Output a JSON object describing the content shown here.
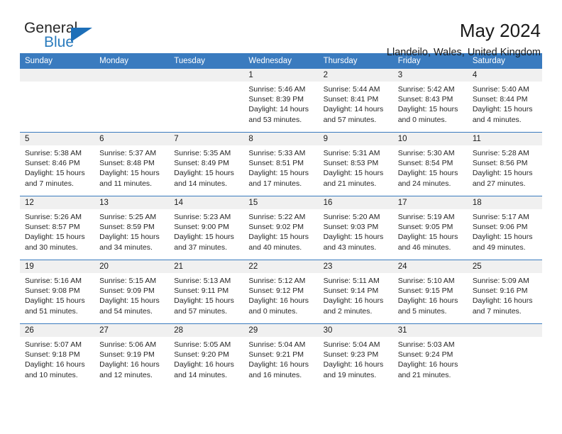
{
  "brand": {
    "name_top": "General",
    "name_bottom": "Blue",
    "triangle_color": "#1d6fb8",
    "blue_text_color": "#2a7bbd"
  },
  "header": {
    "title": "May 2024",
    "location": "Llandeilo, Wales, United Kingdom",
    "accent_color": "#3a7bbf",
    "daynum_band_color": "#f0f0f0"
  },
  "weekday_headers": [
    "Sunday",
    "Monday",
    "Tuesday",
    "Wednesday",
    "Thursday",
    "Friday",
    "Saturday"
  ],
  "labels": {
    "sunrise_prefix": "Sunrise: ",
    "sunset_prefix": "Sunset: ",
    "daylight_prefix": "Daylight: "
  },
  "weeks": [
    [
      {
        "day": "",
        "empty": true
      },
      {
        "day": "",
        "empty": true
      },
      {
        "day": "",
        "empty": true
      },
      {
        "day": "1",
        "sunrise": "Sunrise: 5:46 AM",
        "sunset": "Sunset: 8:39 PM",
        "daylight": "Daylight: 14 hours and 53 minutes."
      },
      {
        "day": "2",
        "sunrise": "Sunrise: 5:44 AM",
        "sunset": "Sunset: 8:41 PM",
        "daylight": "Daylight: 14 hours and 57 minutes."
      },
      {
        "day": "3",
        "sunrise": "Sunrise: 5:42 AM",
        "sunset": "Sunset: 8:43 PM",
        "daylight": "Daylight: 15 hours and 0 minutes."
      },
      {
        "day": "4",
        "sunrise": "Sunrise: 5:40 AM",
        "sunset": "Sunset: 8:44 PM",
        "daylight": "Daylight: 15 hours and 4 minutes."
      }
    ],
    [
      {
        "day": "5",
        "sunrise": "Sunrise: 5:38 AM",
        "sunset": "Sunset: 8:46 PM",
        "daylight": "Daylight: 15 hours and 7 minutes."
      },
      {
        "day": "6",
        "sunrise": "Sunrise: 5:37 AM",
        "sunset": "Sunset: 8:48 PM",
        "daylight": "Daylight: 15 hours and 11 minutes."
      },
      {
        "day": "7",
        "sunrise": "Sunrise: 5:35 AM",
        "sunset": "Sunset: 8:49 PM",
        "daylight": "Daylight: 15 hours and 14 minutes."
      },
      {
        "day": "8",
        "sunrise": "Sunrise: 5:33 AM",
        "sunset": "Sunset: 8:51 PM",
        "daylight": "Daylight: 15 hours and 17 minutes."
      },
      {
        "day": "9",
        "sunrise": "Sunrise: 5:31 AM",
        "sunset": "Sunset: 8:53 PM",
        "daylight": "Daylight: 15 hours and 21 minutes."
      },
      {
        "day": "10",
        "sunrise": "Sunrise: 5:30 AM",
        "sunset": "Sunset: 8:54 PM",
        "daylight": "Daylight: 15 hours and 24 minutes."
      },
      {
        "day": "11",
        "sunrise": "Sunrise: 5:28 AM",
        "sunset": "Sunset: 8:56 PM",
        "daylight": "Daylight: 15 hours and 27 minutes."
      }
    ],
    [
      {
        "day": "12",
        "sunrise": "Sunrise: 5:26 AM",
        "sunset": "Sunset: 8:57 PM",
        "daylight": "Daylight: 15 hours and 30 minutes."
      },
      {
        "day": "13",
        "sunrise": "Sunrise: 5:25 AM",
        "sunset": "Sunset: 8:59 PM",
        "daylight": "Daylight: 15 hours and 34 minutes."
      },
      {
        "day": "14",
        "sunrise": "Sunrise: 5:23 AM",
        "sunset": "Sunset: 9:00 PM",
        "daylight": "Daylight: 15 hours and 37 minutes."
      },
      {
        "day": "15",
        "sunrise": "Sunrise: 5:22 AM",
        "sunset": "Sunset: 9:02 PM",
        "daylight": "Daylight: 15 hours and 40 minutes."
      },
      {
        "day": "16",
        "sunrise": "Sunrise: 5:20 AM",
        "sunset": "Sunset: 9:03 PM",
        "daylight": "Daylight: 15 hours and 43 minutes."
      },
      {
        "day": "17",
        "sunrise": "Sunrise: 5:19 AM",
        "sunset": "Sunset: 9:05 PM",
        "daylight": "Daylight: 15 hours and 46 minutes."
      },
      {
        "day": "18",
        "sunrise": "Sunrise: 5:17 AM",
        "sunset": "Sunset: 9:06 PM",
        "daylight": "Daylight: 15 hours and 49 minutes."
      }
    ],
    [
      {
        "day": "19",
        "sunrise": "Sunrise: 5:16 AM",
        "sunset": "Sunset: 9:08 PM",
        "daylight": "Daylight: 15 hours and 51 minutes."
      },
      {
        "day": "20",
        "sunrise": "Sunrise: 5:15 AM",
        "sunset": "Sunset: 9:09 PM",
        "daylight": "Daylight: 15 hours and 54 minutes."
      },
      {
        "day": "21",
        "sunrise": "Sunrise: 5:13 AM",
        "sunset": "Sunset: 9:11 PM",
        "daylight": "Daylight: 15 hours and 57 minutes."
      },
      {
        "day": "22",
        "sunrise": "Sunrise: 5:12 AM",
        "sunset": "Sunset: 9:12 PM",
        "daylight": "Daylight: 16 hours and 0 minutes."
      },
      {
        "day": "23",
        "sunrise": "Sunrise: 5:11 AM",
        "sunset": "Sunset: 9:14 PM",
        "daylight": "Daylight: 16 hours and 2 minutes."
      },
      {
        "day": "24",
        "sunrise": "Sunrise: 5:10 AM",
        "sunset": "Sunset: 9:15 PM",
        "daylight": "Daylight: 16 hours and 5 minutes."
      },
      {
        "day": "25",
        "sunrise": "Sunrise: 5:09 AM",
        "sunset": "Sunset: 9:16 PM",
        "daylight": "Daylight: 16 hours and 7 minutes."
      }
    ],
    [
      {
        "day": "26",
        "sunrise": "Sunrise: 5:07 AM",
        "sunset": "Sunset: 9:18 PM",
        "daylight": "Daylight: 16 hours and 10 minutes."
      },
      {
        "day": "27",
        "sunrise": "Sunrise: 5:06 AM",
        "sunset": "Sunset: 9:19 PM",
        "daylight": "Daylight: 16 hours and 12 minutes."
      },
      {
        "day": "28",
        "sunrise": "Sunrise: 5:05 AM",
        "sunset": "Sunset: 9:20 PM",
        "daylight": "Daylight: 16 hours and 14 minutes."
      },
      {
        "day": "29",
        "sunrise": "Sunrise: 5:04 AM",
        "sunset": "Sunset: 9:21 PM",
        "daylight": "Daylight: 16 hours and 16 minutes."
      },
      {
        "day": "30",
        "sunrise": "Sunrise: 5:04 AM",
        "sunset": "Sunset: 9:23 PM",
        "daylight": "Daylight: 16 hours and 19 minutes."
      },
      {
        "day": "31",
        "sunrise": "Sunrise: 5:03 AM",
        "sunset": "Sunset: 9:24 PM",
        "daylight": "Daylight: 16 hours and 21 minutes."
      },
      {
        "day": "",
        "empty": true
      }
    ]
  ]
}
